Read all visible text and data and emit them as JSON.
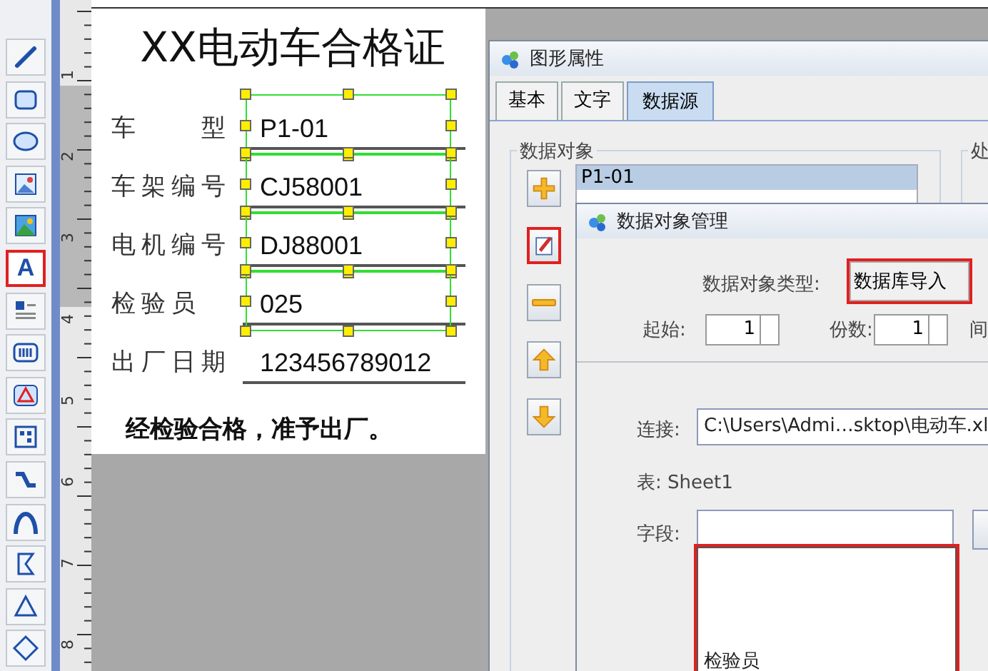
{
  "toolbar": {
    "tools": [
      {
        "kind": "line",
        "selected": false
      },
      {
        "kind": "rect",
        "selected": false
      },
      {
        "kind": "ellipse",
        "selected": false
      },
      {
        "kind": "image",
        "selected": false
      },
      {
        "kind": "picture",
        "selected": false
      },
      {
        "kind": "text",
        "label": "A",
        "selected": true
      },
      {
        "kind": "richtext",
        "selected": false
      },
      {
        "kind": "barcode",
        "selected": false
      },
      {
        "kind": "shape",
        "selected": false
      },
      {
        "kind": "qrcode",
        "selected": false
      },
      {
        "kind": "curve",
        "selected": false
      },
      {
        "kind": "arc",
        "selected": false
      },
      {
        "kind": "polygon",
        "selected": false
      },
      {
        "kind": "triangle",
        "selected": false
      },
      {
        "kind": "diamond",
        "selected": false
      }
    ]
  },
  "ruler": {
    "marks": [
      "1",
      "2",
      "3",
      "4",
      "5",
      "6",
      "7",
      "8"
    ]
  },
  "label": {
    "title": "XX电动车合格证",
    "rows": [
      {
        "name": "车　　型",
        "value": "P1-01",
        "selected": true
      },
      {
        "name": "车架编号",
        "value": "CJ58001",
        "selected": true
      },
      {
        "name": "电机编号",
        "value": "DJ88001",
        "selected": true
      },
      {
        "name": "检验员",
        "value": "025",
        "selected": true
      },
      {
        "name": "出厂日期",
        "value": "123456789012",
        "selected": false
      }
    ],
    "footer": "经检验合格，准予出厂。"
  },
  "properties_dialog": {
    "title": "图形属性",
    "tabs": [
      {
        "label": "基本",
        "selected": false
      },
      {
        "label": "文字",
        "selected": false
      },
      {
        "label": "数据源",
        "selected": true
      }
    ],
    "data_objects": {
      "title": "数据对象",
      "items": [
        {
          "label": "P1-01",
          "selected": true
        }
      ],
      "buttons": [
        {
          "kind": "add",
          "highlighted": false
        },
        {
          "kind": "edit",
          "highlighted": true
        },
        {
          "kind": "remove",
          "highlighted": false
        },
        {
          "kind": "up",
          "highlighted": false
        },
        {
          "kind": "down",
          "highlighted": false
        }
      ]
    },
    "processing_group": {
      "title": "处"
    }
  },
  "data_object_dialog": {
    "title": "数据对象管理",
    "type_label": "数据对象类型:",
    "type_value": "数据库导入",
    "start_label": "起始:",
    "start_value": "1",
    "copies_label": "份数:",
    "copies_value": "1",
    "interval_label": "间",
    "connection_label": "连接:",
    "connection_value": "C:\\Users\\Admi…sktop\\电动车.xl",
    "table_label": "表: Sheet1",
    "field_label": "字段:",
    "field_options": [
      "检验员"
    ]
  }
}
